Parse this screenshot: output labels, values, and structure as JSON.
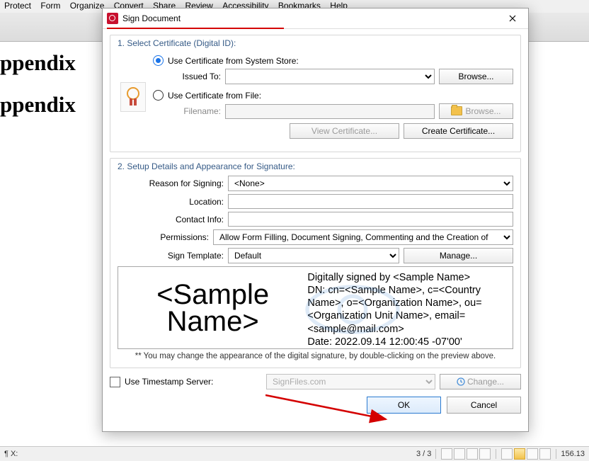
{
  "menu": {
    "items": [
      "Protect",
      "Form",
      "Organize",
      "Convert",
      "Share",
      "Review",
      "Accessibility",
      "Bookmarks",
      "Help"
    ]
  },
  "doc_bg": {
    "line1": "ppendix",
    "line2": "ppendix"
  },
  "dialog": {
    "title": "Sign Document",
    "section1": {
      "title": "1. Select Certificate (Digital ID):",
      "opt_system": "Use Certificate from System Store:",
      "issued_to": "Issued To:",
      "browse": "Browse...",
      "opt_file": "Use Certificate from File:",
      "filename": "Filename:",
      "browse2": "Browse...",
      "view_cert": "View Certificate...",
      "create_cert": "Create Certificate..."
    },
    "section2": {
      "title": "2. Setup Details and Appearance for Signature:",
      "reason_lbl": "Reason for Signing:",
      "reason_val": "<None>",
      "location_lbl": "Location:",
      "contact_lbl": "Contact Info:",
      "permissions_lbl": "Permissions:",
      "permissions_val": "Allow Form Filling, Document Signing, Commenting and the Creation of",
      "template_lbl": "Sign Template:",
      "template_val": "Default",
      "manage": "Manage...",
      "preview_name": "<Sample Name>",
      "preview_text": "Digitally signed by <Sample Name>\nDN: cn=<Sample Name>, c=<Country Name>, o=<Organization Name>, ou=<Organization Unit Name>, email=<sample@mail.com>\nDate: 2022.09.14 12:00:45 -07'00'",
      "note": "** You may change the appearance of the digital signature, by double-clicking on the preview above."
    },
    "timestamp": {
      "checkbox_lbl": "Use Timestamp Server:",
      "server": "SignFiles.com",
      "change": "Change..."
    },
    "footer": {
      "ok": "OK",
      "cancel": "Cancel"
    }
  },
  "status": {
    "xy": "¶   X:",
    "page": "3 / 3",
    "zoom": "156.13"
  }
}
